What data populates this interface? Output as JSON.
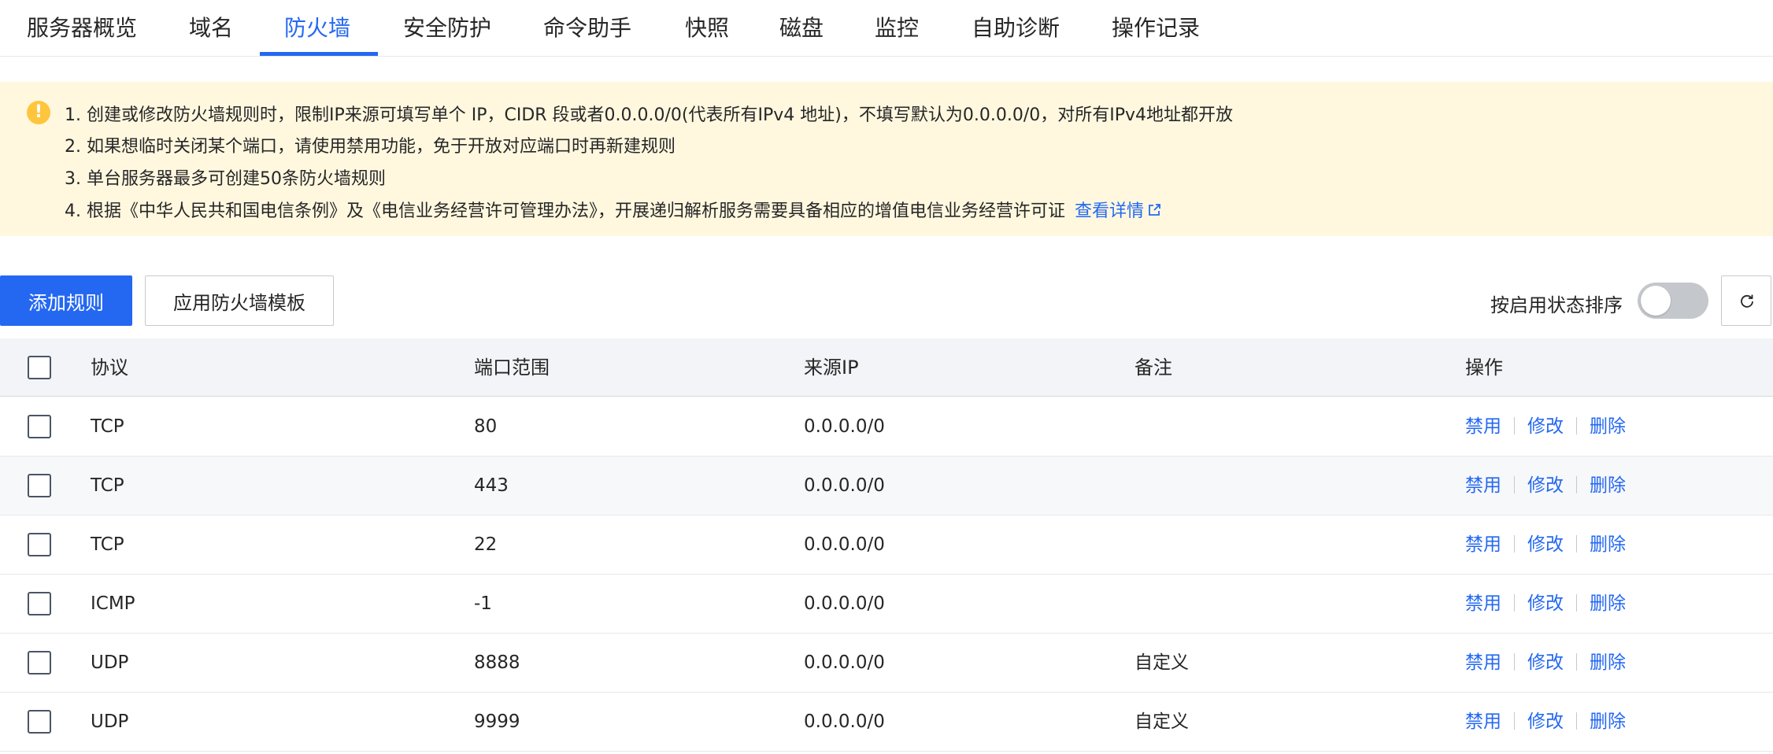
{
  "tabs": [
    "服务器概览",
    "域名",
    "防火墙",
    "安全防护",
    "命令助手",
    "快照",
    "磁盘",
    "监控",
    "自助诊断",
    "操作记录"
  ],
  "active_tab": "防火墙",
  "notice": {
    "lines": [
      "1. 创建或修改防火墙规则时，限制IP来源可填写单个 IP，CIDR 段或者0.0.0.0/0(代表所有IPv4 地址)，不填写默认为0.0.0.0/0，对所有IPv4地址都开放",
      "2. 如果想临时关闭某个端口，请使用禁用功能，免于开放对应端口时再新建规则",
      "3. 单台服务器最多可创建50条防火墙规则",
      "4. 根据《中华人民共和国电信条例》及《电信业务经营许可管理办法》，开展递归解析服务需要具备相应的增值电信业务经营许可证"
    ],
    "link": "查看详情"
  },
  "toolbar": {
    "add_rule": "添加规则",
    "apply_template": "应用防火墙模板",
    "sort_label": "按启用状态排序",
    "sort_enabled": false
  },
  "table": {
    "columns": [
      "协议",
      "端口范围",
      "来源IP",
      "备注",
      "操作"
    ],
    "rows": [
      {
        "protocol": "TCP",
        "port": "80",
        "source": "0.0.0.0/0",
        "note": ""
      },
      {
        "protocol": "TCP",
        "port": "443",
        "source": "0.0.0.0/0",
        "note": ""
      },
      {
        "protocol": "TCP",
        "port": "22",
        "source": "0.0.0.0/0",
        "note": ""
      },
      {
        "protocol": "ICMP",
        "port": "-1",
        "source": "0.0.0.0/0",
        "note": ""
      },
      {
        "protocol": "UDP",
        "port": "8888",
        "source": "0.0.0.0/0",
        "note": "自定义"
      },
      {
        "protocol": "UDP",
        "port": "9999",
        "source": "0.0.0.0/0",
        "note": "自定义"
      }
    ],
    "actions": {
      "disable": "禁用",
      "edit": "修改",
      "delete": "删除"
    }
  },
  "colors": {
    "accent": "#2468f2",
    "notice_bg": "#fff8df",
    "warning": "#ffc53d"
  }
}
